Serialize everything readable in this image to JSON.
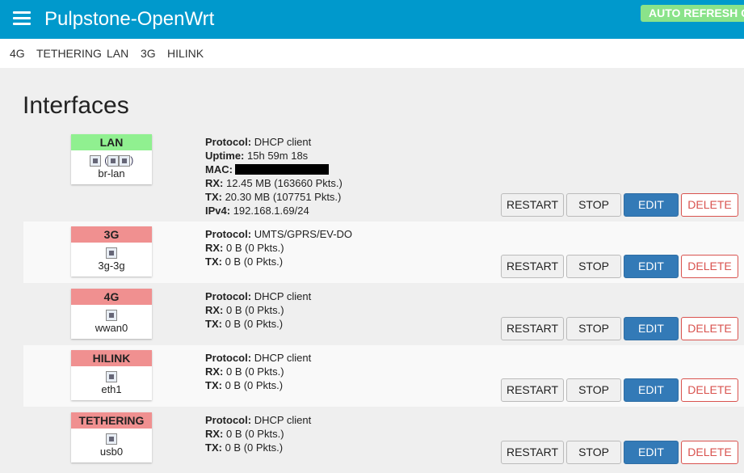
{
  "header": {
    "brand": "Pulpstone-OpenWrt",
    "auto_refresh": "AUTO REFRESH ON"
  },
  "tabs": [
    "4G",
    "TETHERING",
    "LAN",
    "3G",
    "HILINK"
  ],
  "page_title": "Interfaces",
  "buttons": {
    "restart": "RESTART",
    "stop": "STOP",
    "edit": "EDIT",
    "delete": "DELETE"
  },
  "interfaces": [
    {
      "name": "LAN",
      "status": "up",
      "device": "br-lan",
      "protocol_label": "Protocol:",
      "protocol": "DHCP client",
      "uptime_label": "Uptime:",
      "uptime": "15h 59m 18s",
      "mac_label": "MAC:",
      "rx_label": "RX:",
      "rx": "12.45 MB (163660 Pkts.)",
      "tx_label": "TX:",
      "tx": "20.30 MB (107751 Pkts.)",
      "ipv4_label": "IPv4:",
      "ipv4": "192.168.1.69/24"
    },
    {
      "name": "3G",
      "status": "down",
      "device": "3g-3g",
      "protocol_label": "Protocol:",
      "protocol": "UMTS/GPRS/EV-DO",
      "rx_label": "RX:",
      "rx": "0 B (0 Pkts.)",
      "tx_label": "TX:",
      "tx": "0 B (0 Pkts.)"
    },
    {
      "name": "4G",
      "status": "down",
      "device": "wwan0",
      "protocol_label": "Protocol:",
      "protocol": "DHCP client",
      "rx_label": "RX:",
      "rx": "0 B (0 Pkts.)",
      "tx_label": "TX:",
      "tx": "0 B (0 Pkts.)"
    },
    {
      "name": "HILINK",
      "status": "down",
      "device": "eth1",
      "protocol_label": "Protocol:",
      "protocol": "DHCP client",
      "rx_label": "RX:",
      "rx": "0 B (0 Pkts.)",
      "tx_label": "TX:",
      "tx": "0 B (0 Pkts.)"
    },
    {
      "name": "TETHERING",
      "status": "down",
      "device": "usb0",
      "protocol_label": "Protocol:",
      "protocol": "DHCP client",
      "rx_label": "RX:",
      "rx": "0 B (0 Pkts.)",
      "tx_label": "TX:",
      "tx": "0 B (0 Pkts.)"
    }
  ],
  "colors": {
    "header": "#0099cc",
    "status_up": "#90f090",
    "status_down": "#f09090",
    "edit_button": "#337ab7",
    "delete_button": "#d9534f"
  }
}
